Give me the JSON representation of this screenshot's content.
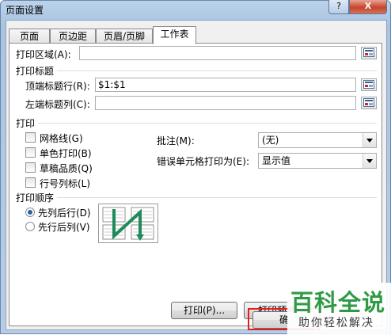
{
  "window": {
    "title": "页面设置",
    "help": "?",
    "close": "X"
  },
  "tabs": [
    "页面",
    "页边距",
    "页眉/页脚",
    "工作表"
  ],
  "print_area": {
    "label": "打印区域(A):",
    "value": ""
  },
  "print_titles": {
    "label": "打印标题",
    "rows": {
      "label": "顶端标题行(R):",
      "value": "$1:$1"
    },
    "cols": {
      "label": "左端标题列(C):",
      "value": ""
    }
  },
  "print": {
    "label": "打印",
    "checkboxes": [
      {
        "label": "网格线(G)",
        "checked": false
      },
      {
        "label": "单色打印(B)",
        "checked": false
      },
      {
        "label": "草稿品质(Q)",
        "checked": false
      },
      {
        "label": "行号列标(L)",
        "checked": false
      }
    ],
    "comments": {
      "label": "批注(M):",
      "value": "(无)"
    },
    "errors": {
      "label": "错误单元格打印为(E):",
      "value": "显示值"
    }
  },
  "page_order": {
    "label": "打印顺序",
    "options": [
      {
        "label": "先列后行(D)",
        "selected": true
      },
      {
        "label": "先行后列(V)",
        "selected": false
      }
    ]
  },
  "buttons": {
    "print": "打印(P)...",
    "preview": "打印预览",
    "ok": "确"
  },
  "watermark": {
    "brand": "百科全说",
    "sub": "助你轻松解决"
  },
  "colors": {
    "accent": "#2a5fa8",
    "highlight": "#e02020",
    "brand_green": "#2f9a46"
  }
}
